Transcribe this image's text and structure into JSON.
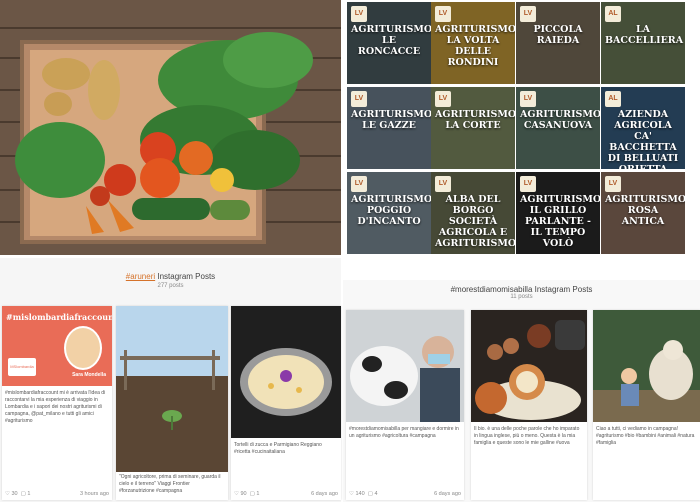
{
  "tiles": [
    {
      "title": "Agriturismo Le Roncacce",
      "logo": "LV",
      "bg": "#4c5d62"
    },
    {
      "title": "Agriturismo La Volta delle Rondini",
      "logo": "LV",
      "bg": "#c49a3a"
    },
    {
      "title": "Piccola Raieda",
      "logo": "LV",
      "bg": "#7a6e5a"
    },
    {
      "title": "La Baccelliera",
      "logo": "AL",
      "bg": "#6b7a57"
    },
    {
      "title": "Agriturismo Le Gazze",
      "logo": "LV",
      "bg": "#6e7f8e"
    },
    {
      "title": "Agriturismo La Corte",
      "logo": "LV",
      "bg": "#7f8b62"
    },
    {
      "title": "Agriturismo Casanuova",
      "logo": "LV",
      "bg": "#5f7a6c"
    },
    {
      "title": "Azienda Agricola Ca' Bacchetta di Belluati Orietta",
      "logo": "AL",
      "bg": "#375c80"
    },
    {
      "title": "Agriturismo Poggio d'Incanto",
      "logo": "LV",
      "bg": "#7c8d97"
    },
    {
      "title": "Alba del Borgo Società Agricola e Agriturismo",
      "logo": "LV",
      "bg": "#6c7054"
    },
    {
      "title": "Agriturismo Il Grillo Parlante - Il Tempo Volò",
      "logo": "LV",
      "bg": "#2a2a2a"
    },
    {
      "title": "Agriturismo Rosa Antica",
      "logo": "LV",
      "bg": "#8b6e5c"
    }
  ],
  "ig_left": {
    "tag": "#aruneri",
    "title_suffix": " Instagram Posts",
    "count": "277 posts",
    "cards": [
      {
        "banner": "#mislombardiafraccount",
        "name": "Sara Mondella",
        "logo_text": "MSlombardia",
        "caption": "#mislombardiafraccount mi è arrivata l'idea di raccontarvi la mia esperienza di viaggio in Lombardia e i sapori dei nostri agriturismi di campagna, @pat_milano e tutti gli amici #agriturismo",
        "likes": "30",
        "comments": "1",
        "time": "3 hours ago"
      },
      {
        "caption": "\"Ogni agricoltore, prima di seminare, guarda il cielo e il terreno\" Viaggi Frontier #forzanutrizione #campagna",
        "likes": "",
        "comments": "",
        "time": ""
      },
      {
        "caption": "Tortelli di zucca e Parmigiano Reggiano #ricetta #cucinaitaliana",
        "likes": "90",
        "comments": "1",
        "time": "6 days ago"
      }
    ]
  },
  "ig_right": {
    "title": "#morestdiamomisabilla Instagram Posts",
    "count": "11 posts",
    "cards": [
      {
        "caption": "#morestdiamomisabilla per mangiare e dormire in un agriturismo #agricoltura #campagna",
        "likes": "140",
        "comments": "4",
        "time": "6 days ago"
      },
      {
        "caption": "Il bio. è una delle poche parole che ho imparato in lingua inglese, più o meno. Questa è la mia famiglia e queste sono le mie galline #uova",
        "likes": "",
        "comments": "",
        "time": ""
      },
      {
        "caption": "Ciao a tutti, ci vediamo in campagna! #agriturismo #bio #bambini #animali #natura #famiglia",
        "likes": "",
        "comments": "",
        "time": ""
      }
    ]
  }
}
